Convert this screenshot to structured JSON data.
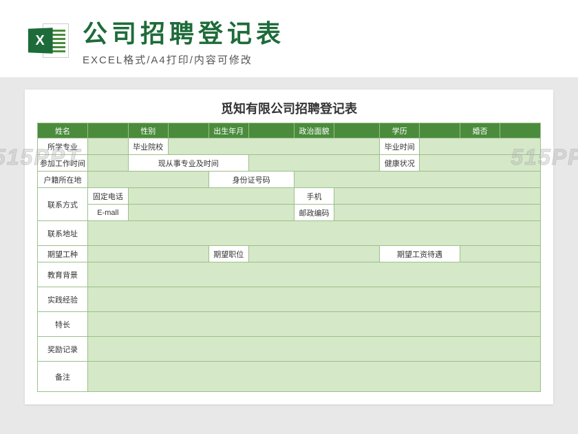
{
  "header": {
    "icon_letter": "X",
    "main_title": "公司招聘登记表",
    "sub_title": "EXCEL格式/A4打印/内容可修改"
  },
  "form": {
    "title": "觅知有限公司招聘登记表",
    "hdr": {
      "name": "姓名",
      "gender": "性别",
      "birth": "出生年月",
      "political": "政治面貌",
      "education": "学历",
      "marital": "婚否"
    },
    "r2": {
      "major": "所学专业",
      "school": "毕业院校",
      "gradtime": "毕业时间"
    },
    "r3": {
      "worktime": "参加工作时间",
      "current": "现从事专业及时间",
      "health": "健康状况"
    },
    "r4": {
      "hukou": "户籍所在地",
      "idno": "身份证号码"
    },
    "r5": {
      "contact": "联系方式",
      "tel": "固定电话",
      "mobile": "手机",
      "email": "E-mall",
      "post": "邮政编码"
    },
    "r6": {
      "addr": "联系地址"
    },
    "r7": {
      "jobtype": "期望工种",
      "position": "期望职位",
      "salary": "期望工资待遇"
    },
    "r8": {
      "edu": "教育背景"
    },
    "r9": {
      "exp": "实践经验"
    },
    "r10": {
      "specialty": "特长"
    },
    "r11": {
      "award": "奖励记录"
    },
    "r12": {
      "remark": "备注"
    }
  },
  "watermark": "515PPT"
}
